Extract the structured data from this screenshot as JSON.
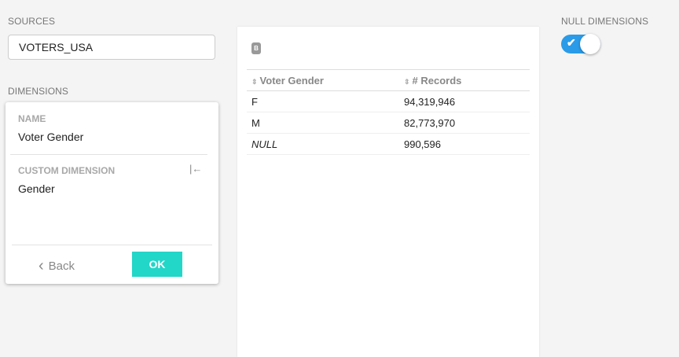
{
  "sources": {
    "label": "SOURCES",
    "value": "VOTERS_USA"
  },
  "dimensions": {
    "label": "DIMENSIONS",
    "name_label": "NAME",
    "name_value": "Voter Gender",
    "custom_label": "CUSTOM DIMENSION",
    "custom_value": "Gender",
    "back_label": "Back",
    "ok_label": "OK"
  },
  "table": {
    "db_icon": "B",
    "headers": [
      "Voter Gender",
      "# Records"
    ],
    "rows": [
      [
        "F",
        "94,319,946"
      ],
      [
        "M",
        "82,773,970"
      ],
      [
        "NULL",
        "990,596"
      ]
    ]
  },
  "null_dimensions": {
    "label": "NULL DIMENSIONS",
    "enabled": true
  },
  "colors": {
    "accent": "#22d6c8",
    "toggle": "#2a9be8"
  }
}
